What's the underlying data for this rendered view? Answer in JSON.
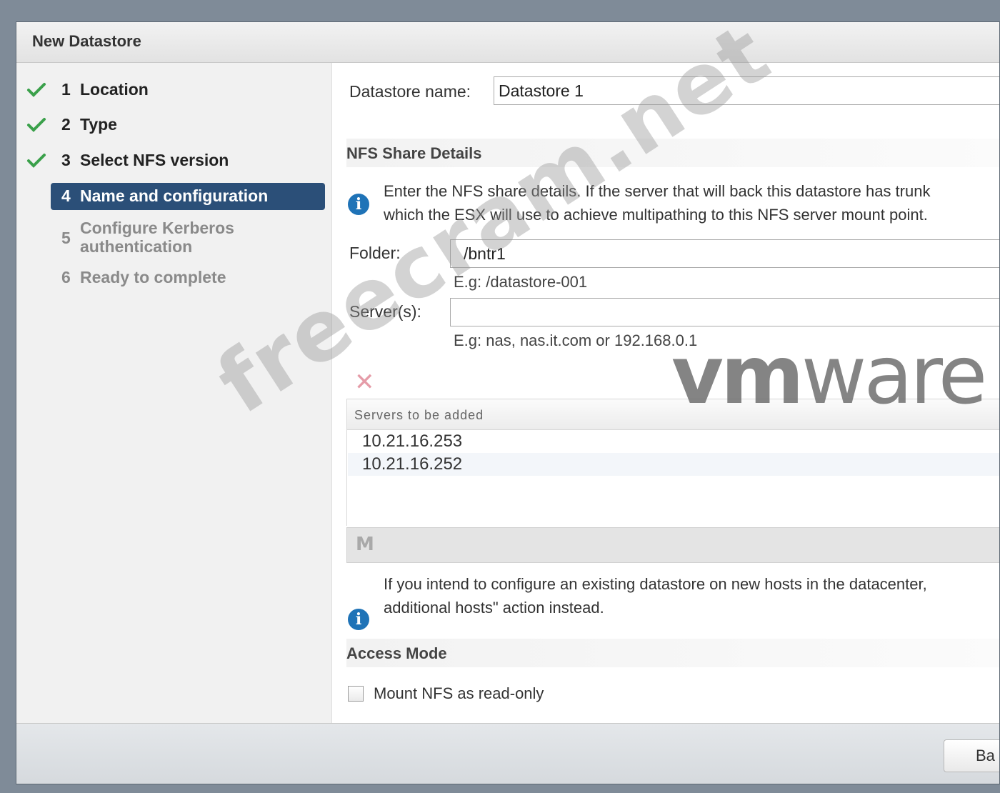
{
  "dialog": {
    "title": "New Datastore"
  },
  "steps": [
    {
      "number": "1",
      "label": "Location",
      "state": "done"
    },
    {
      "number": "2",
      "label": "Type",
      "state": "done"
    },
    {
      "number": "3",
      "label": "Select NFS version",
      "state": "done"
    },
    {
      "number": "4",
      "label": "Name and configuration",
      "state": "active"
    },
    {
      "number": "5",
      "label": "Configure Kerberos authentication",
      "state": "todo"
    },
    {
      "number": "6",
      "label": "Ready to complete",
      "state": "todo"
    }
  ],
  "form": {
    "datastore_name_label": "Datastore name:",
    "datastore_name_value": "Datastore 1",
    "nfs_section_title": "NFS Share Details",
    "nfs_info_line1": "Enter the NFS share details. If the server that will back this datastore has trunk",
    "nfs_info_line2": "which the ESX will use to achieve multipathing to this NFS server mount point.",
    "folder_label": "Folder:",
    "folder_value": "/bntr1",
    "folder_hint": "E.g: /datastore-001",
    "servers_label": "Server(s):",
    "servers_value": "",
    "servers_hint": "E.g: nas, nas.it.com or 192.168.0.1"
  },
  "servers_table": {
    "header": "Servers to be added",
    "rows": [
      "10.21.16.253",
      "10.21.16.252"
    ]
  },
  "existing_info": {
    "line1": "If you intend to configure an existing datastore on new hosts in the datacenter,",
    "line2": "additional hosts\" action instead."
  },
  "access_mode": {
    "title": "Access Mode",
    "checkbox_label": "Mount NFS as read-only",
    "checked": false
  },
  "footer": {
    "back_label": "Ba"
  },
  "overlays": {
    "logo_bold": "vm",
    "logo_light": "ware",
    "watermark": "freecram.net"
  },
  "colors": {
    "active_step": "#2b4f78",
    "check": "#3aa04a",
    "info": "#1f73b7",
    "remove": "#e59ca8"
  },
  "icons": [
    "check-icon",
    "info-icon",
    "remove-icon",
    "filter-icon"
  ]
}
